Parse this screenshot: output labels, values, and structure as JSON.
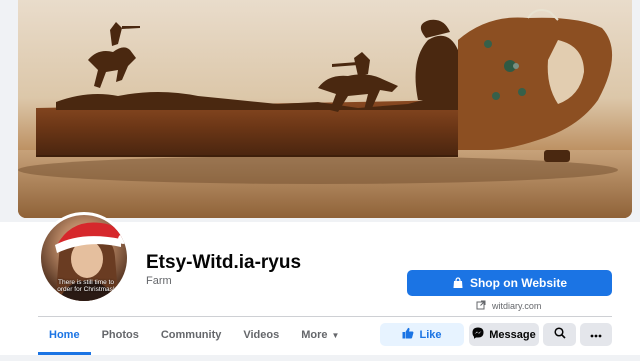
{
  "cover": {
    "description_icon": "cover-photo"
  },
  "profile": {
    "avatar_caption": "There is still time to order for Christmas!",
    "name": "Etsy-Witd.ia-ryus",
    "category": "Farm"
  },
  "actions": {
    "shop_label": "Shop on Website",
    "website_text": "witdiary.com",
    "like_label": "Like",
    "message_label": "Message"
  },
  "tabs": [
    {
      "label": "Home",
      "active": true
    },
    {
      "label": "Photos",
      "active": false
    },
    {
      "label": "Community",
      "active": false
    },
    {
      "label": "Videos",
      "active": false
    },
    {
      "label": "More",
      "active": false
    }
  ],
  "colors": {
    "accent": "#1b74e4",
    "like_bg": "#e7f3ff",
    "secondary_bg": "#e4e6eb",
    "text_primary": "#050505",
    "text_secondary": "#65676b"
  }
}
